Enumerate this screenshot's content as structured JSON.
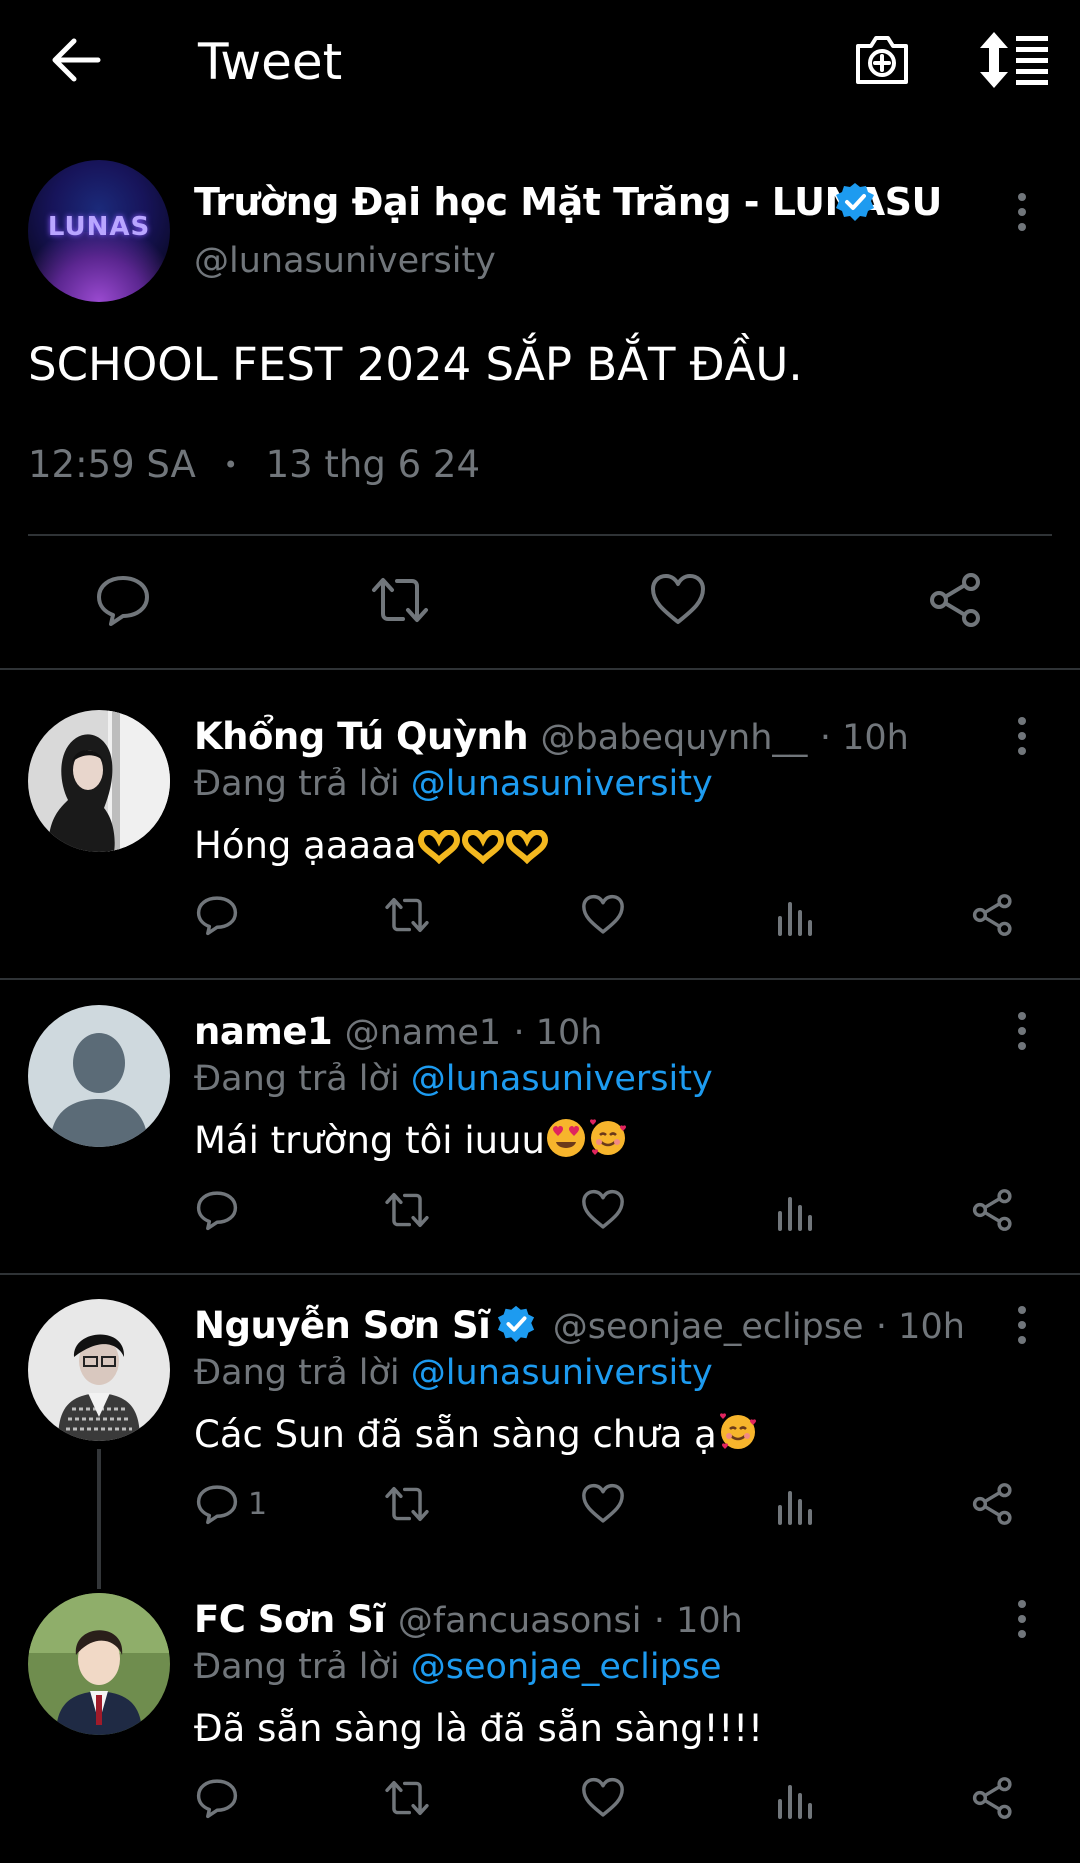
{
  "header": {
    "title": "Tweet"
  },
  "main_tweet": {
    "avatar_text": "LUNAS",
    "name": "Trường Đại học Mặt Trăng - LUNASU",
    "handle": "@lunasuniversity",
    "text": "SCHOOL FEST 2024 SẮP BẮT ĐẦU.",
    "time": "12:59 SA",
    "dot": "•",
    "date": "13 thg 6 24"
  },
  "replies": [
    {
      "name": "Khổng Tú Quỳnh",
      "handle": "@babequynh__",
      "time": "· 10h",
      "replying_label": "Đang trả lời ",
      "replying_to": "@lunasuniversity",
      "text": "Hóng ạaaaa",
      "emoji": [
        "heart-hands-emoji",
        "heart-hands-emoji",
        "heart-hands-emoji"
      ],
      "reply_count": ""
    },
    {
      "name": "name1",
      "handle": "@name1",
      "time": "· 10h",
      "replying_label": "Đang trả lời ",
      "replying_to": "@lunasuniversity",
      "text": "Mái trường tôi iuuu",
      "emoji": [
        "heart-eyes-emoji",
        "smiling-hearts-emoji"
      ],
      "reply_count": ""
    },
    {
      "name": "Nguyễn Sơn Sĩ",
      "handle": "@seonjae_eclipse",
      "time": "· 10h",
      "replying_label": "Đang trả lời ",
      "replying_to": "@lunasuniversity",
      "text": "Các Sun đã sẵn sàng chưa ạ",
      "emoji": [
        "smiling-hearts-emoji"
      ],
      "reply_count": "1"
    },
    {
      "name": "FC Sơn Sĩ",
      "handle": "@fancuasonsi",
      "time": "· 10h",
      "replying_label": "Đang trả lời ",
      "replying_to": "@seonjae_eclipse",
      "text": "Đã sẵn sàng là đã sẵn sàng!!!!",
      "emoji": [],
      "reply_count": ""
    }
  ],
  "colors": {
    "background": "#000000",
    "text": "#e7e9ea",
    "muted": "#71767b",
    "accent": "#1d9bf0",
    "divider": "#2f3336"
  }
}
